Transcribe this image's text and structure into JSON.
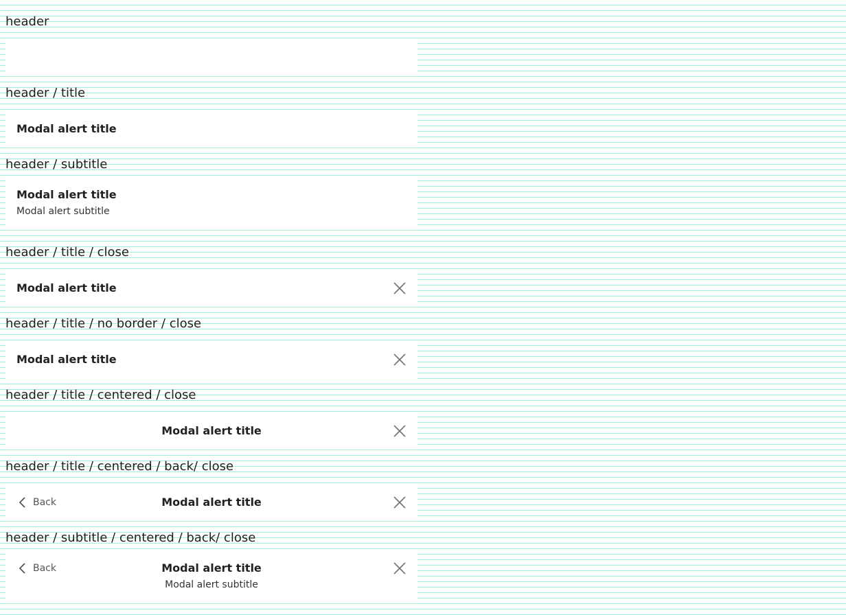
{
  "sections": [
    {
      "label": "header"
    },
    {
      "label": "header / title",
      "title": "Modal alert title"
    },
    {
      "label": "header / subtitle",
      "title": "Modal alert title",
      "subtitle": "Modal alert subtitle"
    },
    {
      "label": "header / title / close",
      "title": "Modal alert title"
    },
    {
      "label": "header / title / no border / close",
      "title": "Modal alert title"
    },
    {
      "label": "header / title / centered / close",
      "title": "Modal alert title"
    },
    {
      "label": "header / title / centered / back/ close",
      "title": "Modal alert title",
      "back_label": "Back"
    },
    {
      "label": "header / subtitle / centered / back/ close",
      "title": "Modal alert title",
      "subtitle": "Modal alert subtitle",
      "back_label": "Back"
    }
  ],
  "icons": {
    "close": "close-icon",
    "back": "chevron-left-icon"
  },
  "colors": {
    "grid_line": "#a6e8e4",
    "panel_background": "#ffffff",
    "title_text": "#222222",
    "icon": "#777777"
  }
}
